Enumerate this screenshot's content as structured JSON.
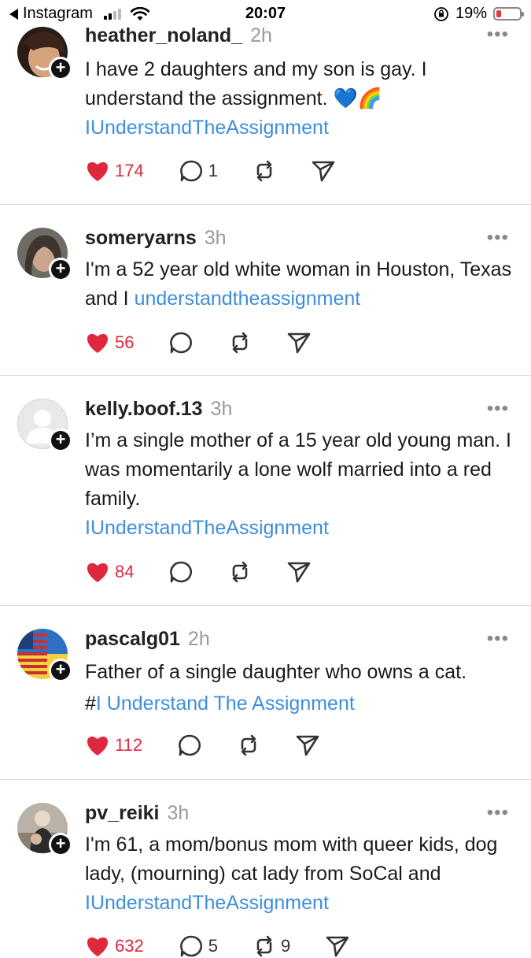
{
  "status_bar": {
    "back_app": "Instagram",
    "time": "20:07",
    "battery": "19%",
    "battery_level": 0.19
  },
  "posts": [
    {
      "username": "heather_noland_",
      "time": "2h",
      "text": "I have 2 daughters and my son is gay. I understand the assignment. 💙🌈",
      "hashtag": "IUnderstandTheAssignment",
      "likes": "174",
      "replies": "1"
    },
    {
      "username": "someryarns",
      "time": "3h",
      "text": "I'm a 52 year old white woman in Houston, Texas and I ",
      "hashtag": "understandtheassignment",
      "likes": "56",
      "replies": ""
    },
    {
      "username": "kelly.boof.13",
      "time": "3h",
      "text": "I’m a single mother of a 15 year old young man.  I was momentarily a lone wolf married into a red family.",
      "hashtag": "IUnderstandTheAssignment",
      "likes": "84",
      "replies": ""
    },
    {
      "username": "pascalg01",
      "time": "2h",
      "text": "Father of a single daughter who owns a cat.",
      "hashtag_prefix": "#",
      "hashtag": "I Understand The Assignment",
      "likes": "112",
      "replies": ""
    },
    {
      "username": "pv_reiki",
      "time": "3h",
      "text": "I'm 61, a mom/bonus mom with queer kids, dog lady, (mourning) cat lady from SoCal and ",
      "hashtag": "IUnderstandTheAssignment",
      "likes": "632",
      "replies": "5",
      "reposts": "9"
    }
  ],
  "icons": {
    "like": "heart-icon",
    "reply": "comment-icon",
    "repost": "repost-icon",
    "share": "send-icon",
    "more": "more-icon",
    "follow": "plus-icon"
  },
  "colors": {
    "like": "#e0283d",
    "hashtag": "#3f8edc",
    "divider": "#dcdcdc"
  }
}
